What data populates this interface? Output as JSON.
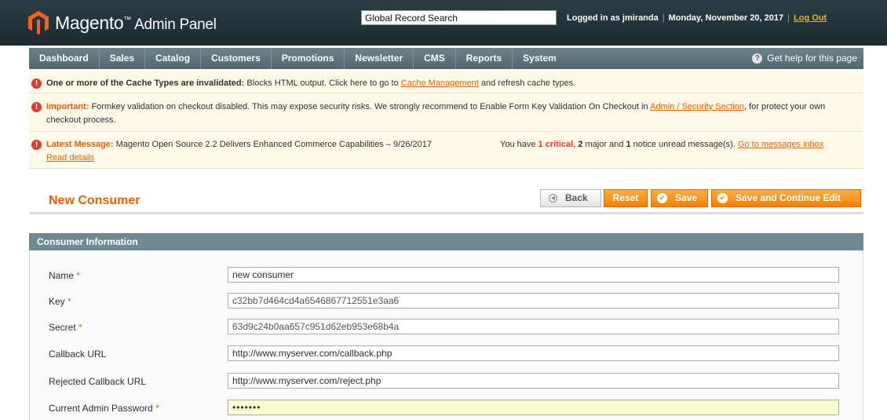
{
  "header": {
    "logo_main": "Magento",
    "logo_tm": "™",
    "logo_sub": "Admin Panel",
    "search_value": "Global Record Search",
    "logged_in": "Logged in as jmiranda",
    "date": "Monday, November 20, 2017",
    "logout": "Log Out"
  },
  "nav": {
    "items": [
      "Dashboard",
      "Sales",
      "Catalog",
      "Customers",
      "Promotions",
      "Newsletter",
      "CMS",
      "Reports",
      "System"
    ],
    "help": "Get help for this page"
  },
  "notices": {
    "cache": {
      "bold": "One or more of the Cache Types are invalidated:",
      "text": " Blocks HTML output. Click here to go to ",
      "link": "Cache Management",
      "tail": " and refresh cache types."
    },
    "formkey": {
      "bold": "Important:",
      "text": " Formkey validation on checkout disabled. This may expose security risks. We strongly recommend to Enable Form Key Validation On Checkout in ",
      "link": "Admin / Security Section",
      "tail": ", for protect your own checkout process."
    },
    "latest": {
      "bold": "Latest Message:",
      "text": " Magento Open Source 2.2 Delivers Enhanced Commerce Capabilities – 9/26/2017",
      "read": "Read details",
      "have": "You have ",
      "critical_count": "1",
      "critical": "critical",
      "major_count": "2",
      "major": " major and ",
      "notice_count": "1",
      "notice": " notice unread message(s). ",
      "inbox": "Go to messages inbox"
    }
  },
  "page": {
    "title": "New Consumer",
    "back": "Back",
    "reset": "Reset",
    "save": "Save",
    "save_continue": "Save and Continue Edit"
  },
  "fieldset": {
    "title": "Consumer Information",
    "required_mark": "*",
    "name_label": "Name",
    "name_value": "new consumer",
    "key_label": "Key",
    "key_value": "c32bb7d464cd4a6546867712551e3aa6",
    "secret_label": "Secret",
    "secret_value": "63d9c24b0aa657c951d62eb953e68b4a",
    "callback_label": "Callback URL",
    "callback_value": "http://www.myserver.com/callback.php",
    "rejected_label": "Rejected Callback URL",
    "rejected_value": "http://www.myserver.com/reject.php",
    "password_label": "Current Admin Password",
    "password_value": "•••••••"
  },
  "colors": {
    "accent_orange": "#eb5e00",
    "header_dark": "#1b2a30",
    "nav": "#5d7378",
    "notice_bg": "#fff9e9",
    "password_bg": "#fafdcc"
  }
}
